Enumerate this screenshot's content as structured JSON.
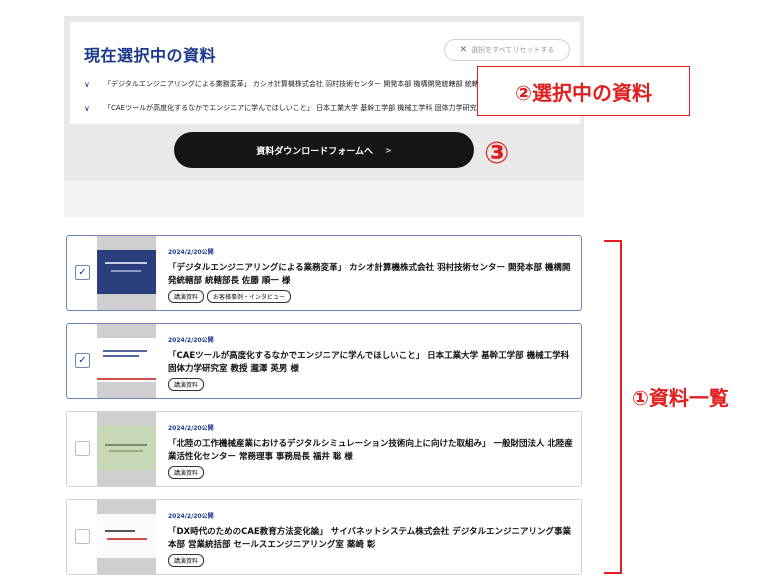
{
  "selection_panel": {
    "title": "現在選択中の資料",
    "reset_label": "選択をすべてリセットする",
    "items": [
      "「デジタルエンジニアリングによる業務変革」 カシオ計算機株式会社 羽村技術センター 開発本部 機構開発統轄部 統轄部長 佐藤 順一",
      "「CAEツールが高度化するなかでエンジニアに学んでほしいこと」 日本工業大学 基幹工学部 機械工学科 固体力学研究室 教授 瀧澤 英"
    ]
  },
  "download_button": {
    "label": "資料ダウンロードフォームへ",
    "arrow": ">"
  },
  "documents": [
    {
      "date": "2024/2/20公開",
      "title": "「デジタルエンジニアリングによる業務変革」 カシオ計算機株式会社 羽村技術センター 開発本部 機構開発統轄部 統轄部長 佐藤 順一 様",
      "tags": [
        "講演資料",
        "お客様事例・インタビュー"
      ],
      "selected": true
    },
    {
      "date": "2024/2/20公開",
      "title": "「CAEツールが高度化するなかでエンジニアに学んでほしいこと」 日本工業大学 基幹工学部 機械工学科 固体力学研究室 教授 瀧澤 英男 様",
      "tags": [
        "講演資料"
      ],
      "selected": true
    },
    {
      "date": "2024/2/20公開",
      "title": "「北陸の工作機械産業におけるデジタルシミュレーション技術向上に向けた取組み」 一般財団法人 北陸産業活性化センター 常務理事 事務局長 福井 聡 様",
      "tags": [
        "講演資料"
      ],
      "selected": false
    },
    {
      "date": "2024/2/20公開",
      "title": "「DX時代のためのCAE教育方法変化論」 サイバネットシステム株式会社 デジタルエンジニアリング事業本部 営業統括部 セールスエンジニアリング室 薬崎 彰",
      "tags": [
        "講演資料"
      ],
      "selected": false
    }
  ],
  "annotations": {
    "list_label": "①資料一覧",
    "selected_label": "②選択中の資料",
    "button_label": "③"
  },
  "colors": {
    "accent": "#1b3a8c",
    "annotation": "#e02020",
    "button": "#151515"
  }
}
